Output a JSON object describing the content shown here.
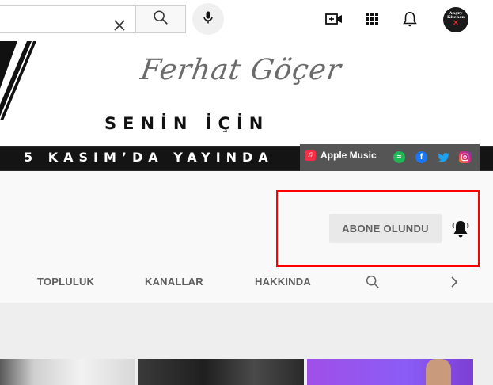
{
  "header": {
    "search": {
      "value": "",
      "clear_icon": "close-icon",
      "search_icon": "search-icon"
    },
    "mic_icon": "microphone-icon",
    "create_icon": "video-create-icon",
    "apps_icon": "apps-grid-icon",
    "notifications_icon": "bell-icon",
    "avatar": {
      "line1": "Angry",
      "line2": "Kitchen",
      "mark": "✕"
    }
  },
  "banner": {
    "signature": "Ferhat Göçer",
    "song_title": "SENİN İÇİN",
    "release_text": "5 KASIM’DA YAYINDA",
    "apple_music_label": "Apple Music",
    "social_icons": [
      "spotify-icon",
      "facebook-icon",
      "twitter-icon",
      "instagram-icon"
    ]
  },
  "channel": {
    "subscribe_label": "ABONE OLUNDU",
    "bell_icon": "notification-bell-icon",
    "tabs": [
      {
        "label": "TOPLULUK"
      },
      {
        "label": "KANALLAR"
      },
      {
        "label": "HAKKINDA"
      }
    ],
    "tab_search_icon": "search-icon",
    "tab_next_icon": "chevron-right-icon"
  },
  "colors": {
    "highlight_border": "#ff0000",
    "subscribe_bg": "#e9e9e9",
    "banner_bar": "#141414"
  }
}
